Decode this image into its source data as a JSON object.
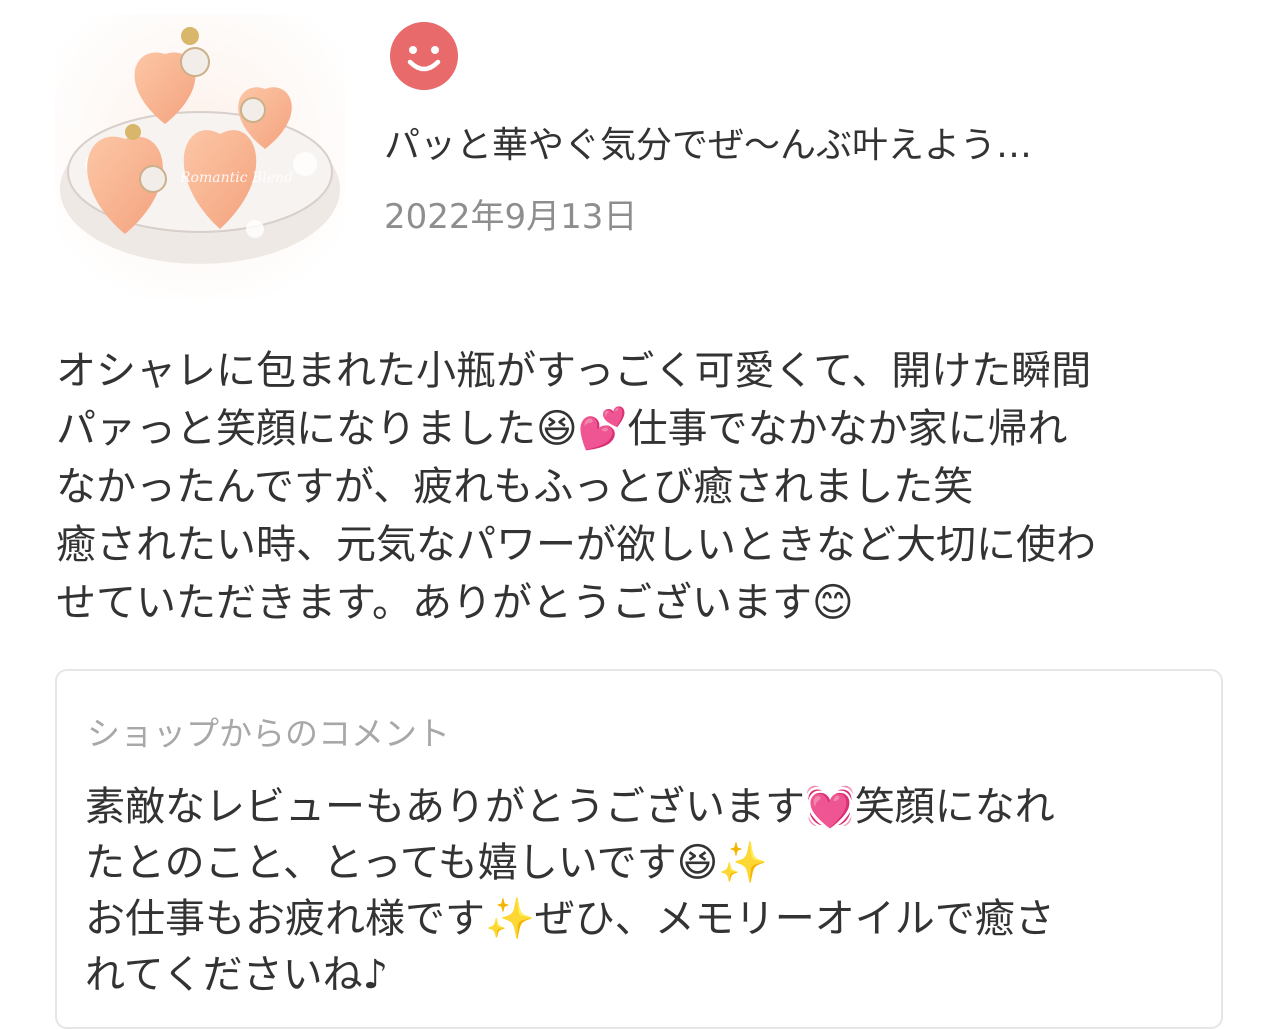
{
  "review": {
    "rating_icon": "smile-face-icon",
    "title": "パッと華やぐ気分でぜ〜んぶ叶えよう…",
    "date": "2022年9月13日",
    "body": "オシャレに包まれた小瓶がすっごく可愛くて、開けた瞬間\nパァっと笑顔になりました😆💕仕事でなかなか家に帰れ\nなかったんですが、疲れもふっとび癒されました笑\n癒されたい時、元気なパワーが欲しいときなど大切に使わ\nせていただきます。ありがとうございます😊"
  },
  "product_image": {
    "name": "heart-soaps-image",
    "label": "Romantic Blend"
  },
  "shop_comment": {
    "heading": "ショップからのコメント",
    "body": "素敵なレビューもありがとうございます💓笑顔になれ\nたとのこと、とっても嬉しいです😆✨\nお仕事もお疲れ様です✨ぜひ、メモリーオイルで癒さ\nれてくださいね♪"
  },
  "colors": {
    "rating_red": "#e86a6a",
    "muted_text": "#8e8e8e",
    "border": "#e6e6e6"
  }
}
